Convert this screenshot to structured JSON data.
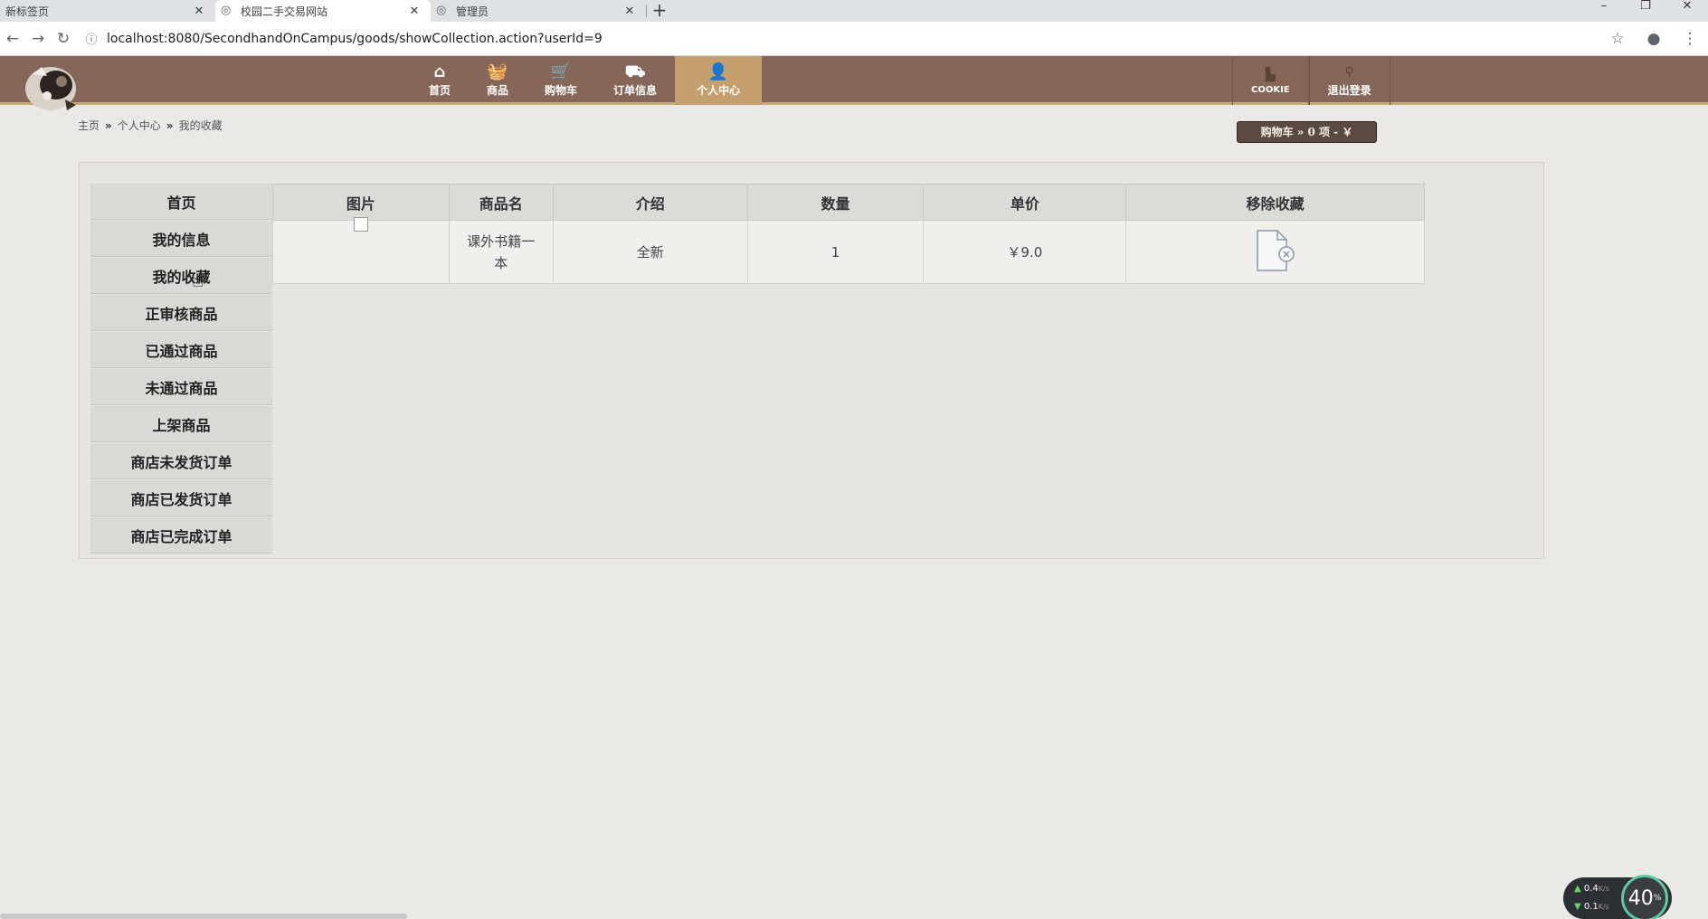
{
  "browser": {
    "tabs": [
      {
        "title": "新标签页",
        "active": false
      },
      {
        "title": "校园二手交易网站",
        "active": true
      },
      {
        "title": "管理员",
        "active": false
      }
    ],
    "url": "localhost:8080/SecondhandOnCampus/goods/showCollection.action?userId=9"
  },
  "header": {
    "nav": [
      {
        "label": "首页",
        "icon": "home-icon",
        "active": false
      },
      {
        "label": "商品",
        "icon": "basket-icon",
        "active": false
      },
      {
        "label": "购物车",
        "icon": "cart-icon",
        "active": false
      },
      {
        "label": "订单信息",
        "icon": "truck-icon",
        "active": false
      },
      {
        "label": "个人中心",
        "icon": "user-icon",
        "active": true
      }
    ],
    "right_nav": [
      {
        "label": "COOKIE",
        "icon": "cookie-icon"
      },
      {
        "label": "退出登录",
        "icon": "logout-icon"
      }
    ],
    "accent_color": "#856658",
    "active_color": "#c5a06e"
  },
  "breadcrumb": [
    "主页",
    "个人中心",
    "我的收藏"
  ],
  "cart_summary": "购物车 » 0 项 - ￥",
  "left_menu": [
    "首页",
    "我的信息",
    "我的收藏",
    "正审核商品",
    "已通过商品",
    "未通过商品",
    "上架商品",
    "商店未发货订单",
    "商店已发货订单",
    "商店已完成订单"
  ],
  "table": {
    "headers": [
      "图片",
      "商品名",
      "介绍",
      "数量",
      "单价",
      "移除收藏"
    ],
    "rows": [
      {
        "name": "课外书籍一本",
        "intro": "全新",
        "qty": "1",
        "price": "￥9.0"
      }
    ]
  },
  "net_widget": {
    "up": "0.4",
    "down": "0.1",
    "unit": "K/s",
    "percent": "40",
    "percent_unit": "%"
  }
}
